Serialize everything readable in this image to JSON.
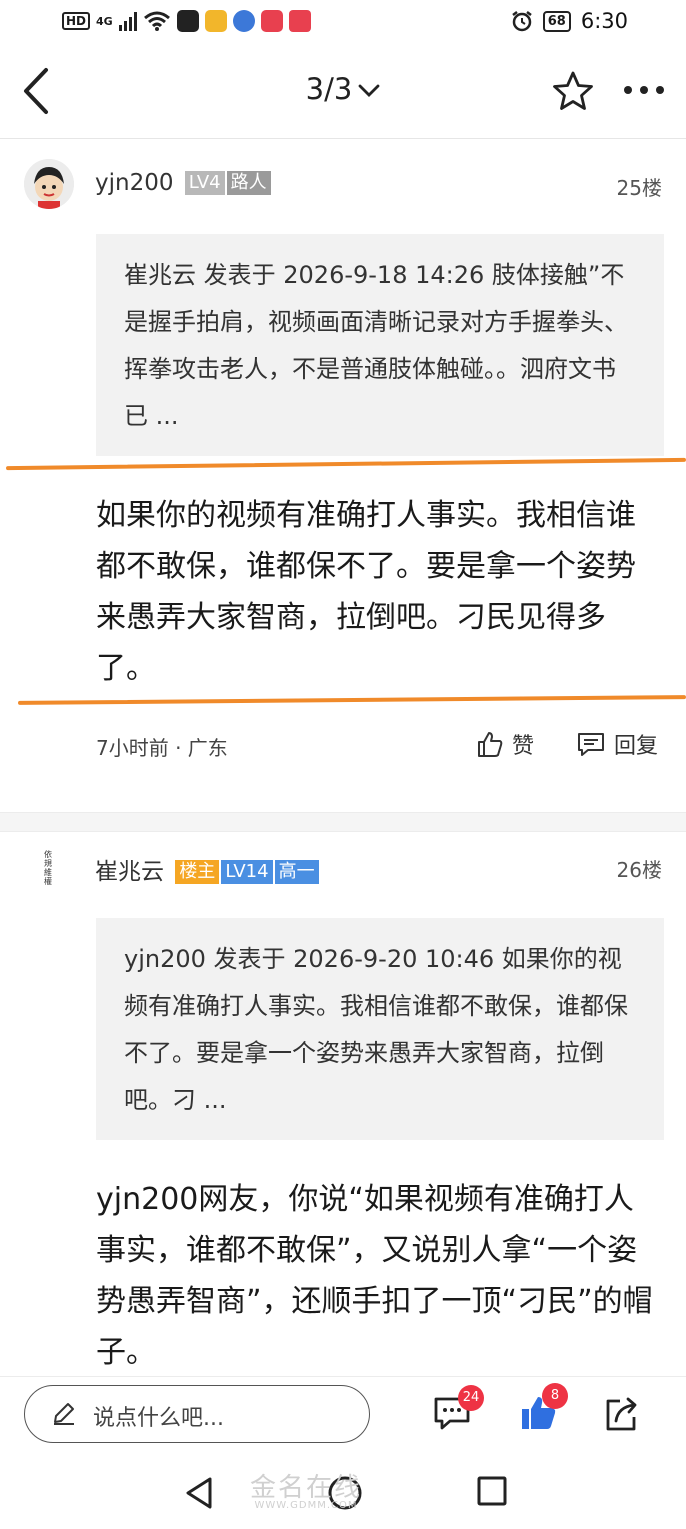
{
  "status_bar": {
    "hd": "HD",
    "signal": "4G",
    "battery": "68",
    "time": "6:30",
    "colors": {
      "weibo": "#f2b62b",
      "chrome": "#3c78d8",
      "app_red": "#e8404f"
    }
  },
  "header": {
    "page_indicator": "3/3",
    "icons": [
      "back-arrow-icon",
      "chevron-down-icon",
      "star-icon",
      "more-icon"
    ]
  },
  "posts": [
    {
      "username": "yjn200",
      "badges": [
        {
          "text": "LV4",
          "color": "#b8b8b8"
        },
        {
          "text": "路人",
          "color": "#9a9a9a"
        }
      ],
      "floor": "25楼",
      "quote": "崔兆云 发表于 2026-9-18 14:26 肢体接触”不是握手拍肩，视频画面清晰记录对方手握拳头、挥拳攻击老人，不是普通肢体触碰。。泗府文书已 ...",
      "body": "如果你的视频有准确打人事实。我相信谁都不敢保，谁都保不了。要是拿一个姿势来愚弄大家智商，拉倒吧。刁民见得多了。",
      "time_location": "7小时前 · 广东",
      "like_label": "赞",
      "reply_label": "回复"
    },
    {
      "username": "崔兆云",
      "badges": [
        {
          "text": "楼主",
          "color": "#f5a623"
        },
        {
          "text": "LV14",
          "color": "#4a8fe2"
        },
        {
          "text": "高一",
          "color": "#4a8fe2"
        }
      ],
      "floor": "26楼",
      "avatar_text": "依規維權",
      "quote": "yjn200 发表于 2026-9-20 10:46 如果你的视频有准确打人事实。我相信谁都不敢保，谁都保不了。要是拿一个姿势来愚弄大家智商，拉倒吧。刁 ...",
      "body": "yjn200网友，你说“如果视频有准确打人事实，谁都不敢保”，又说别人拿“一个姿势愚弄智商”，还顺手扣了一顶“刁民”的帽子。"
    }
  ],
  "bottom_bar": {
    "comment_placeholder": "说点什么吧...",
    "comment_count": "24",
    "like_count": "8",
    "accent": "#2f6fe0"
  },
  "watermark": {
    "text": "金名在线",
    "url": "WWW.GDMM.COM"
  }
}
